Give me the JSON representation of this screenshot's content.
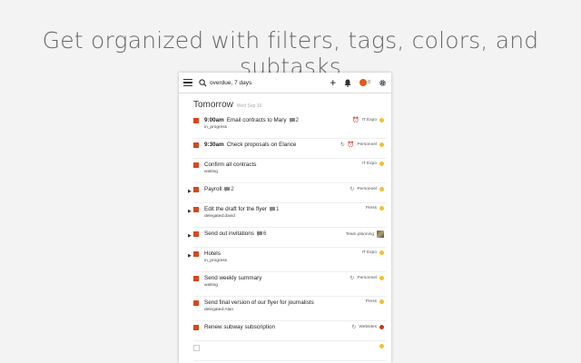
{
  "headline": "Get organized with filters, tags, colors, and subtasks",
  "toolbar": {
    "search_value": "overdue, 7 days",
    "avatar_count": "0"
  },
  "section": {
    "title": "Tomorrow",
    "subtitle": "Wed Sep 10"
  },
  "tasks": [
    {
      "time": "9:00am",
      "title": "Email contracts to Mary",
      "comments": "2",
      "sub": "in_progress",
      "icon": "alarm-clock-icon",
      "project": "IT Expo",
      "color": "#f2c12e",
      "caret": false
    },
    {
      "time": "9:30am",
      "title": "Check proposals on Elance",
      "sub": "",
      "icon": "repeat-icon",
      "icon2": "alarm-clock-icon",
      "project": "Personnel",
      "color": "#f2c12e",
      "caret": false
    },
    {
      "time": "",
      "title": "Confirm all contracts",
      "sub": "waiting",
      "project": "IT Expo",
      "color": "#f2c12e",
      "caret": false
    },
    {
      "time": "",
      "title": "Payroll",
      "comments": "2",
      "sub": "",
      "icon": "repeat-icon",
      "project": "Personnel",
      "color": "#f2c12e",
      "caret": true
    },
    {
      "time": "",
      "title": "Edit the draft for the flyer",
      "comments": "1",
      "sub": "delegated:david",
      "project": "Press",
      "color": "#f2c12e",
      "caret": true
    },
    {
      "time": "",
      "title": "Send out invitations",
      "comments": "6",
      "sub": "",
      "project": "Team planning",
      "color": "",
      "photo": true,
      "caret": true
    },
    {
      "time": "",
      "title": "Hotels",
      "sub": "in_progress",
      "project": "IT Expo",
      "color": "#f2c12e",
      "caret": true
    },
    {
      "time": "",
      "title": "Send weekly summary",
      "sub": "waiting",
      "icon": "repeat-icon",
      "project": "Personnel",
      "color": "#f2c12e",
      "caret": false
    },
    {
      "time": "",
      "title": "Send final version of our flyer for journalists",
      "sub": "delegated:Alan",
      "project": "Press",
      "color": "#f2c12e",
      "caret": false
    },
    {
      "time": "",
      "title": "Renew subway subscription",
      "sub": "",
      "icon": "repeat-icon",
      "project": "Websites",
      "color": "#c9381f",
      "caret": false
    },
    {
      "time": "",
      "title": "",
      "sub": "",
      "project": "",
      "color": "#f2c12e",
      "caret": false,
      "empty": true
    }
  ],
  "colors": {
    "check": "#d34a1d",
    "accent_avatar": "#e05a1a"
  }
}
